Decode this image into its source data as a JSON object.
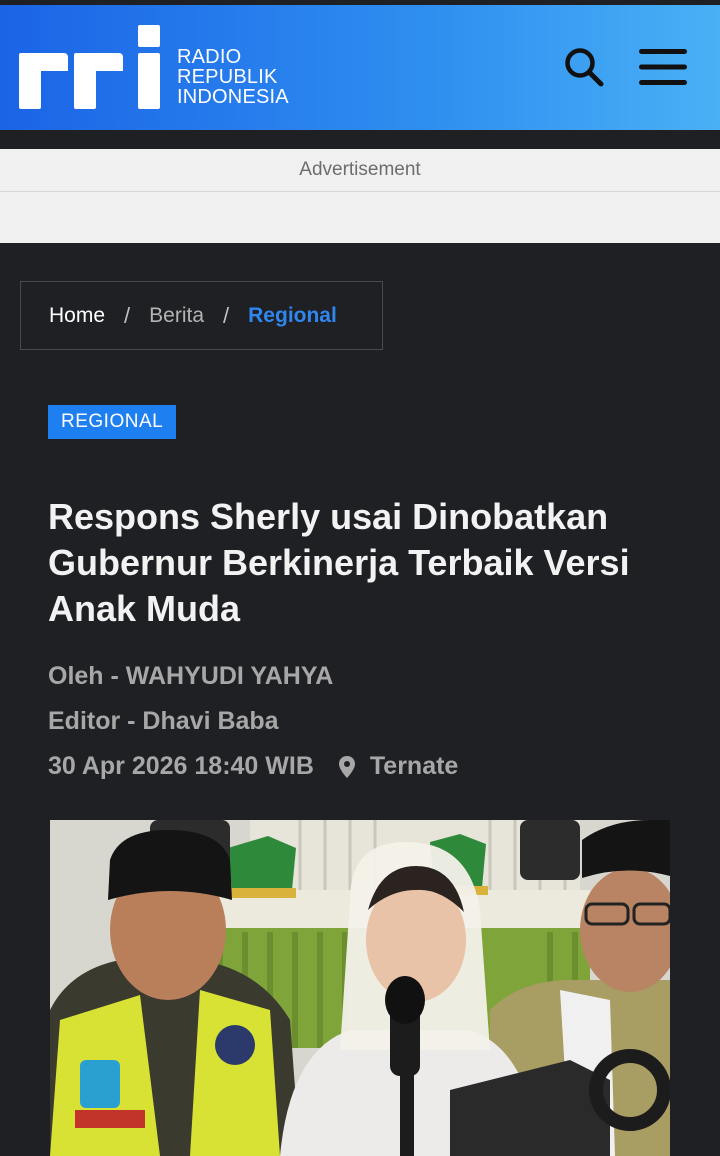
{
  "brand": {
    "logo_text": "rri",
    "name_lines": [
      "RADIO",
      "REPUBLIK",
      "INDONESIA"
    ]
  },
  "header": {
    "search_icon": "search-icon",
    "menu_icon": "hamburger-menu-icon"
  },
  "ad": {
    "label": "Advertisement"
  },
  "breadcrumb": {
    "home": "Home",
    "separator": "/",
    "section": "Berita",
    "current": "Regional"
  },
  "article": {
    "category": "REGIONAL",
    "title": "Respons Sherly usai Dinobatkan Gubernur Berkinerja Terbaik Versi Anak Muda",
    "author": "Oleh - WAHYUDI YAHYA",
    "editor": "Editor - Dhavi Baba",
    "date": "30 Apr 2026 18:40 WIB",
    "location": "Ternate"
  },
  "colors": {
    "header_blue": "#2f8ff0",
    "accent_blue": "#1e7ff0",
    "page_bg": "#1f2024"
  }
}
